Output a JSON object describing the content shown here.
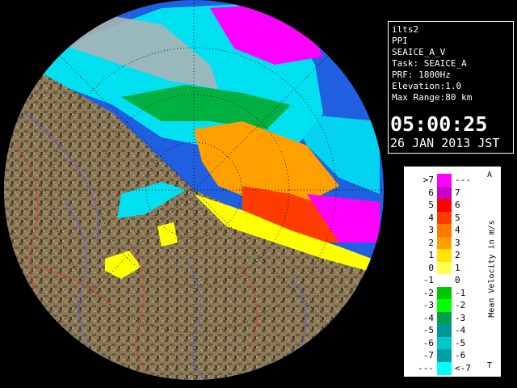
{
  "info": {
    "lines": [
      "ilts2",
      "PPI",
      "SEAICE_A_V",
      "Task: SEAICE_A",
      "PRF: 1800Hz",
      "Elevation:1.0",
      "Max Range:80 km"
    ],
    "time": "05:00:25",
    "date": "26 JAN 2013 JST"
  },
  "legend": {
    "title": "Mean Velocity in m/s",
    "top_marker": "A",
    "bottom_marker": "T",
    "rows": [
      {
        "left": ">7",
        "right": "---",
        "color": "#ff00ff"
      },
      {
        "left": "6",
        "right": "7",
        "color": "#c800c8"
      },
      {
        "left": "5",
        "right": "6",
        "color": "#ff0000"
      },
      {
        "left": "4",
        "right": "5",
        "color": "#ff3c00"
      },
      {
        "left": "3",
        "right": "4",
        "color": "#ff7800"
      },
      {
        "left": "2",
        "right": "3",
        "color": "#ffa000"
      },
      {
        "left": "1",
        "right": "2",
        "color": "#ffe600"
      },
      {
        "left": "0",
        "right": "1",
        "color": "#ffff50"
      },
      {
        "left": "-1",
        "right": "0",
        "color": "#ffffff"
      },
      {
        "left": "-2",
        "right": "-1",
        "color": "#00c800"
      },
      {
        "left": "-3",
        "right": "-2",
        "color": "#00ff00"
      },
      {
        "left": "-4",
        "right": "-3",
        "color": "#00a050"
      },
      {
        "left": "-5",
        "right": "-4",
        "color": "#009696"
      },
      {
        "left": "-6",
        "right": "-5",
        "color": "#00c8c8"
      },
      {
        "left": "-7",
        "right": "-6",
        "color": "#00a0a0"
      },
      {
        "left": "---",
        "right": "<-7",
        "color": "#00ffff"
      }
    ]
  },
  "colors": {
    "background": "#000000",
    "radar_ring": "#2060e0",
    "land": "#8c7a5a",
    "cyan": "#00e0f0",
    "magenta": "#ff00ff",
    "orange": "#ffa000",
    "yellow": "#ffff00",
    "green": "#00c000"
  }
}
